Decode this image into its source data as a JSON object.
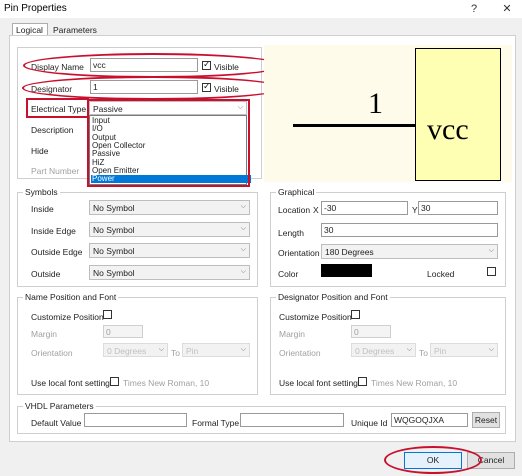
{
  "window": {
    "title": "Pin Properties",
    "help_glyph": "?",
    "close_glyph": "✕"
  },
  "tabs": [
    {
      "label": "Logical",
      "active": true
    },
    {
      "label": "Parameters",
      "active": false
    }
  ],
  "pin": {
    "display_name_label": "Display Name",
    "display_name_value": "vcc",
    "display_name_visible": true,
    "designator_label": "Designator",
    "designator_value": "1",
    "designator_visible": true,
    "visible_label": "Visible",
    "electrical_type_label": "Electrical Type",
    "electrical_type_value": "Passive",
    "description_label": "Description",
    "hide_label": "Hide",
    "part_number_label": "Part Number"
  },
  "electrical_type_options": [
    "Input",
    "I/O",
    "Output",
    "Open Collector",
    "Passive",
    "HiZ",
    "Open Emitter",
    "Power"
  ],
  "electrical_type_highlighted": "Power",
  "preview": {
    "designator_text": "1",
    "name_text": "vcc",
    "body_color": "#ffffb4"
  },
  "symbols": {
    "legend": "Symbols",
    "rows": [
      {
        "label": "Inside",
        "value": "No Symbol"
      },
      {
        "label": "Inside Edge",
        "value": "No Symbol"
      },
      {
        "label": "Outside Edge",
        "value": "No Symbol"
      },
      {
        "label": "Outside",
        "value": "No Symbol"
      }
    ]
  },
  "graphical": {
    "legend": "Graphical",
    "location_label": "Location",
    "x_label": "X",
    "x_value": "-30",
    "y_label": "Y",
    "y_value": "30",
    "length_label": "Length",
    "length_value": "30",
    "orientation_label": "Orientation",
    "orientation_value": "180 Degrees",
    "color_label": "Color",
    "color_value": "#000000",
    "locked_label": "Locked",
    "locked": false
  },
  "name_font": {
    "legend": "Name Position and Font",
    "customize_label": "Customize Position",
    "margin_label": "Margin",
    "margin_value": "0",
    "orientation_label": "Orientation",
    "orientation_value": "0 Degrees",
    "to_label": "To",
    "to_value": "Pin",
    "use_local_label": "Use local font setting",
    "font_value": "Times New Roman, 10"
  },
  "designator_font": {
    "legend": "Designator Position and Font",
    "customize_label": "Customize Position",
    "margin_label": "Margin",
    "margin_value": "0",
    "orientation_label": "Orientation",
    "orientation_value": "0 Degrees",
    "to_label": "To",
    "to_value": "Pin",
    "use_local_label": "Use local font setting",
    "font_value": "Times New Roman, 10"
  },
  "vhdl": {
    "legend": "VHDL Parameters",
    "default_value_label": "Default Value",
    "default_value": "",
    "formal_type_label": "Formal Type",
    "formal_type_value": "",
    "unique_id_label": "Unique Id",
    "unique_id_value": "WQGOQJXA",
    "reset_label": "Reset"
  },
  "footer": {
    "ok_label": "OK",
    "cancel_label": "Cancel"
  }
}
